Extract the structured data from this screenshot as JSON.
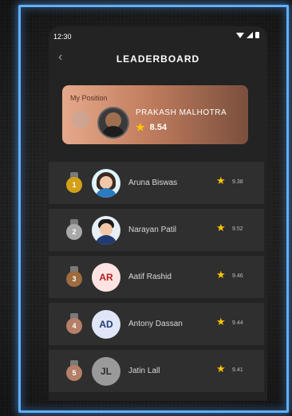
{
  "status_bar": {
    "time": "12:30"
  },
  "header": {
    "back_icon": "chevron-left-icon",
    "title": "LEADERBOARD"
  },
  "my_position": {
    "label": "My Position",
    "name": "PRAKASH MALHOTRA",
    "score": "8.54",
    "colors": {
      "card_start": "#e6a98c",
      "card_end": "#7a4f3d"
    }
  },
  "leaderboard": [
    {
      "rank": "1",
      "name": "Aruna Biswas",
      "score": "9.38",
      "avatar_type": "photo",
      "medal_color": "#d4a017"
    },
    {
      "rank": "2",
      "name": "Narayan Patil",
      "score": "9.52",
      "avatar_type": "photo",
      "medal_color": "#a8a8a8"
    },
    {
      "rank": "3",
      "name": "Aatif Rashid",
      "score": "9.46",
      "avatar_type": "initials",
      "initials": "AR",
      "avatar_bg": "#ffe3e3",
      "avatar_fg": "#b22222",
      "medal_color": "#9c6b3e"
    },
    {
      "rank": "4",
      "name": "Antony Dassan",
      "score": "9.44",
      "avatar_type": "initials",
      "initials": "AD",
      "avatar_bg": "#dfe6f7",
      "avatar_fg": "#1f3b72",
      "medal_color": "#b57f68"
    },
    {
      "rank": "5",
      "name": "Jatin Lall",
      "score": "9.41",
      "avatar_type": "initials",
      "initials": "JL",
      "avatar_bg": "#9a9a9a",
      "avatar_fg": "#2b2b2b",
      "medal_color": "#b57f68"
    }
  ],
  "colors": {
    "accent_frame": "#5fb0ff",
    "star": "#ffc400"
  }
}
